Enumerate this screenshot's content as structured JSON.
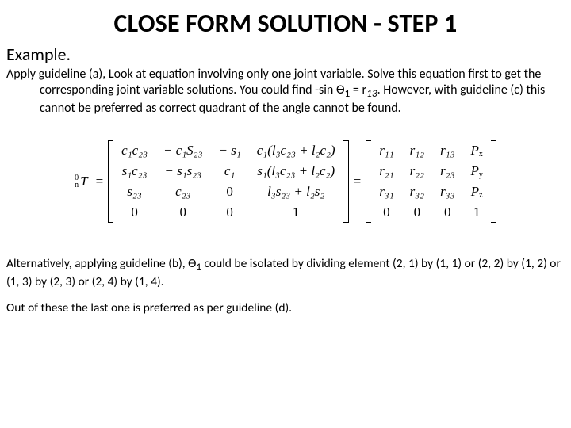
{
  "title": "CLOSE FORM SOLUTION - STEP 1",
  "subtitle": "Example.",
  "para1_line1": "Apply guideline (a), Look at equation involving only one joint variable. Solve this",
  "para1_line2": "equation first to get the corresponding joint variable solutions. You could find -sin",
  "para1_line3_a": "Ɵ",
  "para1_line3_b": "1",
  "para1_line3_c": " = r",
  "para1_line3_d": "13",
  "para1_line3_e": ". However, with guideline (c) this cannot be preferred as correct quadrant",
  "para1_line4": "of the angle cannot be found.",
  "eq": {
    "pre_sup": "0",
    "pre_sub": "n",
    "T": "T",
    "eq": "=",
    "left": {
      "r1": [
        "c₁c₂₃",
        "− c₁S₂₃",
        "− s₁",
        "c₁(l₃c₂₃ + l₂c₂)"
      ],
      "r2": [
        "s₁c₂₃",
        "− s₁s₂₃",
        "c₁",
        "s₁(l₃c₂₃ + l₂c₂)"
      ],
      "r3": [
        "s₂₃",
        "c₂₃",
        "0",
        "l₃s₂₃ + l₂s₂"
      ],
      "r4": [
        "0",
        "0",
        "0",
        "1"
      ]
    },
    "right": {
      "r1": [
        "r₁₁",
        "r₁₂",
        "r₁₃",
        "Pₓ"
      ],
      "r2": [
        "r₂₁",
        "r₂₂",
        "r₂₃",
        "P_y"
      ],
      "r3": [
        "r₃₁",
        "r₃₂",
        "r₃₃",
        "P_z"
      ],
      "r4": [
        "0",
        "0",
        "0",
        "1"
      ]
    }
  },
  "para2_a": "Alternatively, applying guideline (b), Ɵ",
  "para2_b": "1",
  "para2_c": " could be isolated by dividing element (2, 1) by (1, 1) or (2, 2) by (1, 2) or (1, 3) by (2, 3) or (2, 4) by (1, 4).",
  "para3": "Out of these the last one is preferred as per guideline (d)."
}
